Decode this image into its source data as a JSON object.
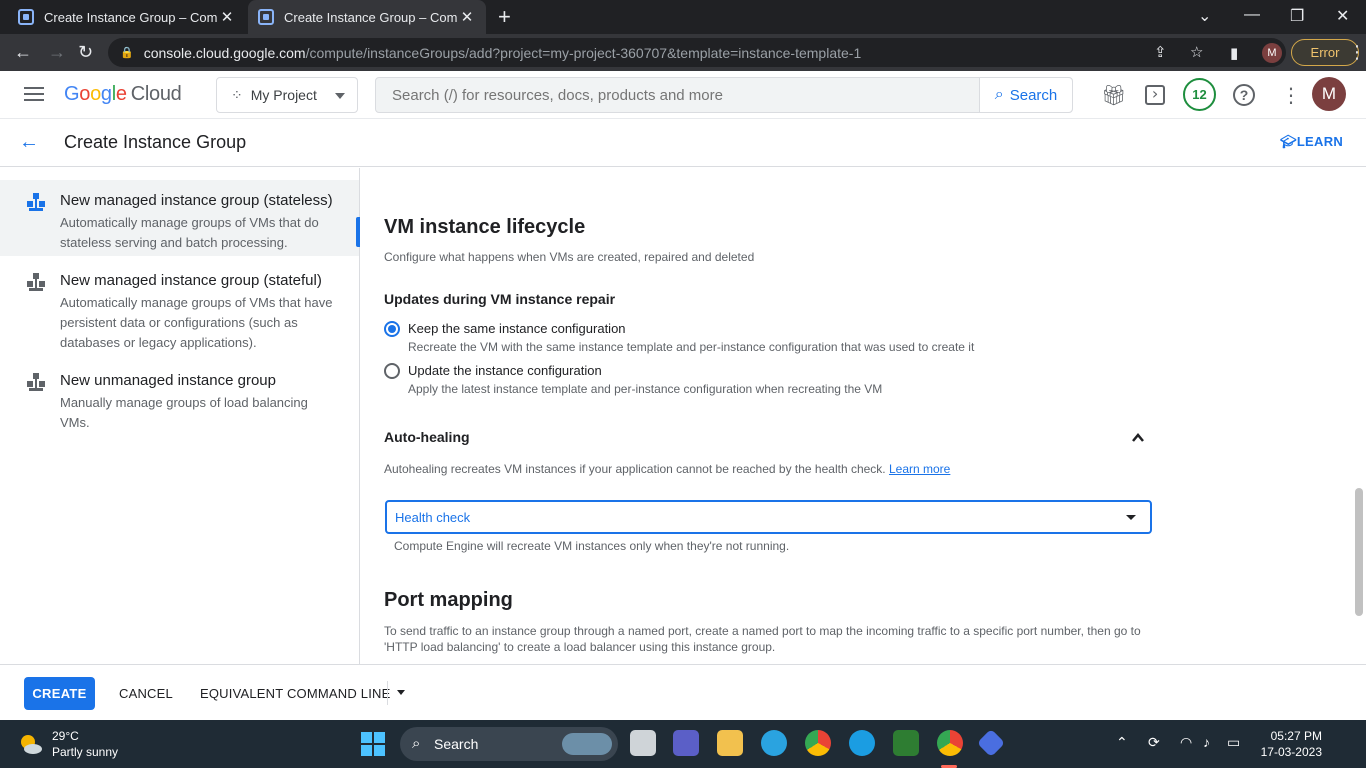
{
  "browser": {
    "tabs": [
      {
        "title": "Create Instance Group – Comput",
        "close": "✕"
      },
      {
        "title": "Create Instance Group – Comput",
        "close": "✕"
      }
    ],
    "new_tab": "+",
    "url_host": "console.cloud.google.com",
    "url_path": "/compute/instanceGroups/add?project=my-project-360707&template=instance-template-1",
    "profile_initial": "M",
    "error_label": "Error"
  },
  "header": {
    "logo_google": [
      "G",
      "o",
      "o",
      "g",
      "l",
      "e"
    ],
    "logo_cloud": "Cloud",
    "project": "My Project",
    "search_placeholder": "Search (/) for resources, docs, products and more",
    "search_button": "Search",
    "notification_count": "12",
    "avatar_initial": "M"
  },
  "page": {
    "title": "Create Instance Group",
    "learn": "LEARN"
  },
  "group_types": [
    {
      "title": "New managed instance group (stateless)",
      "desc": "Automatically manage groups of VMs that do stateless serving and batch processing.",
      "selected": true
    },
    {
      "title": "New managed instance group (stateful)",
      "desc": "Automatically manage groups of VMs that have persistent data or configurations (such as databases or legacy applications).",
      "selected": false
    },
    {
      "title": "New unmanaged instance group",
      "desc": "Manually manage groups of load balancing VMs.",
      "selected": false
    }
  ],
  "lifecycle": {
    "heading": "VM instance lifecycle",
    "desc": "Configure what happens when VMs are created, repaired and deleted",
    "repair_heading": "Updates during VM instance repair",
    "options": [
      {
        "label": "Keep the same instance configuration",
        "desc": "Recreate the VM with the same instance template and per-instance configuration that was used to create it",
        "checked": true
      },
      {
        "label": "Update the instance configuration",
        "desc": "Apply the latest instance template and per-instance configuration when recreating the VM",
        "checked": false
      }
    ]
  },
  "autohealing": {
    "heading": "Auto-healing",
    "desc": "Autohealing recreates VM instances if your application cannot be reached by the health check.",
    "learn_more": "Learn more",
    "select_value": "Health check",
    "helper": "Compute Engine will recreate VM instances only when they're not running."
  },
  "port_mapping": {
    "heading": "Port mapping",
    "desc_line1": "To send traffic to an instance group through a named port, create a named port to map the incoming traffic to a specific port number, then go to",
    "desc_line2": "'HTTP load balancing' to create a load balancer using this instance group."
  },
  "actions": {
    "create": "CREATE",
    "cancel": "CANCEL",
    "command_line": "EQUIVALENT COMMAND LINE"
  },
  "taskbar": {
    "temp": "29°C",
    "condition": "Partly sunny",
    "search": "Search",
    "time": "05:27 PM",
    "date": "17-03-2023"
  },
  "colors": {
    "accent": "#1a73e8",
    "chrome_dark": "#202124",
    "taskbar": "#1f2b35"
  }
}
